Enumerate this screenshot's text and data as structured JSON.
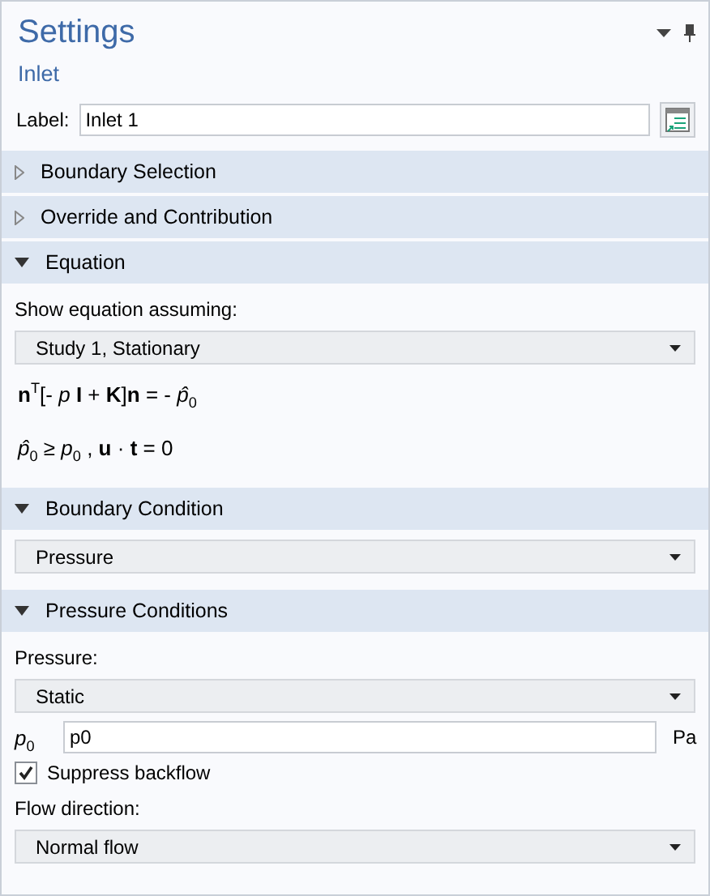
{
  "panel": {
    "title": "Settings",
    "subtitle": "Inlet"
  },
  "label": {
    "caption": "Label:",
    "value": "Inlet 1"
  },
  "sections": [
    {
      "title": "Boundary Selection",
      "expanded": false
    },
    {
      "title": "Override and Contribution",
      "expanded": false
    },
    {
      "title": "Equation",
      "expanded": true,
      "items": [
        {
          "kind": "caption",
          "text": "Show equation assuming:"
        },
        {
          "kind": "select",
          "value": "Study 1, Stationary"
        },
        {
          "kind": "equation",
          "text": "**n**$^{T}$[- *p* **I** + **K**]**n** = - *p̂*$_{0}$"
        },
        {
          "kind": "equation",
          "text": "*p̂*$_{0}$ ≥ *p*$_{0}$ ,  **u** · **t** = 0"
        }
      ]
    },
    {
      "title": "Boundary Condition",
      "expanded": true,
      "items": [
        {
          "kind": "select",
          "value": "Pressure"
        }
      ]
    },
    {
      "title": "Pressure Conditions",
      "expanded": true,
      "items": [
        {
          "kind": "caption",
          "text": "Pressure:"
        },
        {
          "kind": "select",
          "value": "Static"
        },
        {
          "kind": "param",
          "symbol": "*p*$_{0}$",
          "value": "p0",
          "unit": "Pa"
        },
        {
          "kind": "checkbox",
          "text": "Suppress backflow",
          "checked": true
        },
        {
          "kind": "caption",
          "text": "Flow direction:"
        },
        {
          "kind": "select",
          "value": "Normal flow"
        }
      ]
    }
  ]
}
